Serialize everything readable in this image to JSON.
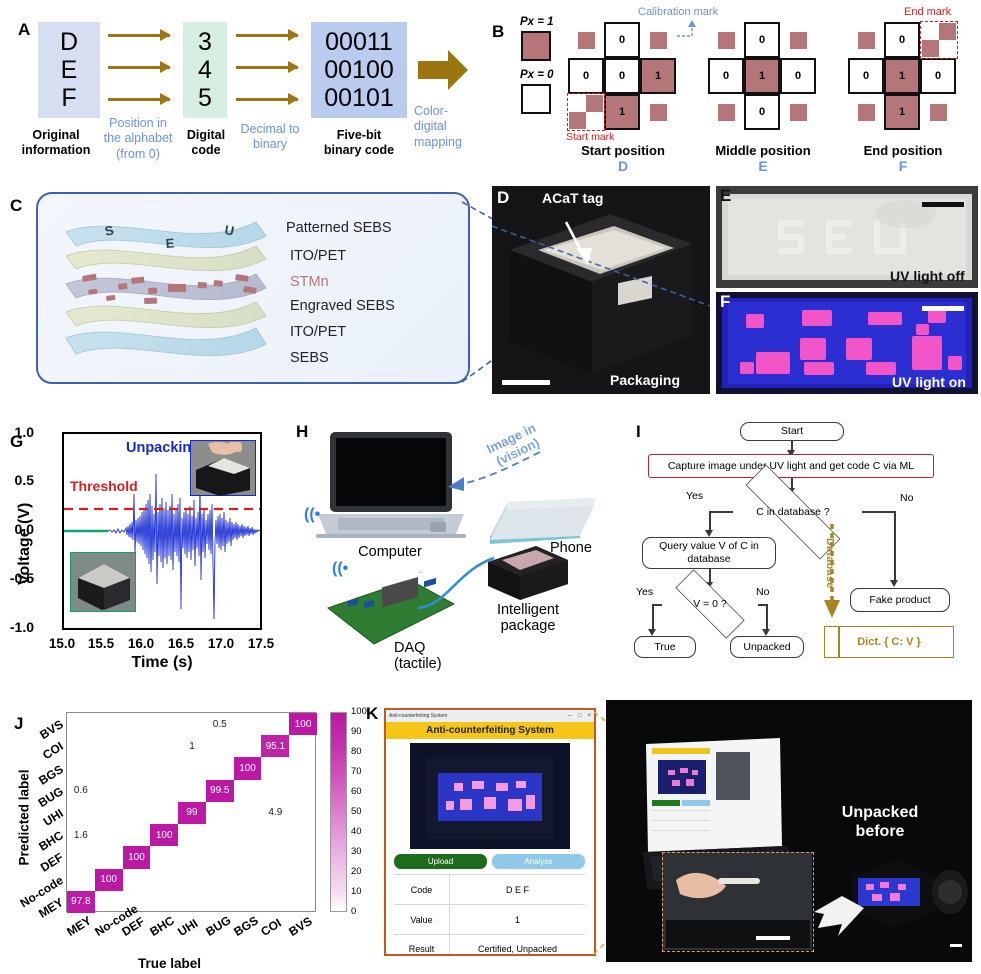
{
  "panels": {
    "A": {
      "letter": "A"
    },
    "B": {
      "letter": "B"
    },
    "C": {
      "letter": "C"
    },
    "D": {
      "letter": "D"
    },
    "E": {
      "letter": "E"
    },
    "F": {
      "letter": "F"
    },
    "G": {
      "letter": "G"
    },
    "H": {
      "letter": "H"
    },
    "I": {
      "letter": "I"
    },
    "J": {
      "letter": "J"
    },
    "K": {
      "letter": "K"
    }
  },
  "panelA": {
    "letters": [
      "D",
      "E",
      "F"
    ],
    "digital_codes": [
      "3",
      "4",
      "5"
    ],
    "binary_codes": [
      "00011",
      "00100",
      "00101"
    ],
    "caption_original": "Original\ninformation",
    "caption_position": "Position in\nthe alphabet\n(from 0)",
    "caption_digital": "Digital\ncode",
    "caption_dec2bin": "Decimal to\nbinary",
    "caption_fivebit": "Five-bit\nbinary code",
    "caption_colormap": "Color-\ndigital\nmapping",
    "arrow_color": "#9a7510",
    "box_colors": {
      "original": "#d6def2",
      "digital": "#d7efe2",
      "binary": "#b9cbee"
    }
  },
  "panelB": {
    "legend_on": "Px = 1",
    "legend_off": "Px = 0",
    "calibration_label": "Calibration mark",
    "start_mark_label": "Start mark",
    "end_mark_label": "End mark",
    "fill_color": "#b5767a",
    "grids": [
      {
        "name": "start",
        "caption": "Start position",
        "letter": "D",
        "bits": {
          "top": "0",
          "left": "0",
          "center": "0",
          "right": "1",
          "bottom": "1"
        },
        "on": {
          "top": false,
          "left": false,
          "center": false,
          "right": true,
          "bottom": true
        }
      },
      {
        "name": "middle",
        "caption": "Middle position",
        "letter": "E",
        "bits": {
          "top": "0",
          "left": "0",
          "center": "1",
          "right": "0",
          "bottom": "0"
        },
        "on": {
          "top": false,
          "left": false,
          "center": true,
          "right": false,
          "bottom": false
        }
      },
      {
        "name": "end",
        "caption": "End position",
        "letter": "F",
        "bits": {
          "top": "0",
          "left": "0",
          "center": "1",
          "right": "0",
          "bottom": "1"
        },
        "on": {
          "top": false,
          "left": false,
          "center": true,
          "right": false,
          "bottom": true
        }
      }
    ]
  },
  "panelC": {
    "layers": [
      "Patterned SEBS",
      "ITO/PET",
      "STMn",
      "Engraved SEBS",
      "ITO/PET",
      "SEBS"
    ],
    "pattern_letters": [
      "S",
      "E",
      "U"
    ],
    "stmn_color": "#b5767a",
    "border_color": "#3c63ac"
  },
  "panelD": {
    "annotation": "ACaT  tag",
    "caption": "Packaging"
  },
  "panelE": {
    "caption": "UV light off",
    "engraved_text": "SEU"
  },
  "panelF": {
    "caption": "UV light on"
  },
  "panelG": {
    "chart_data": {
      "type": "line",
      "title": "",
      "xlabel": "Time (s)",
      "ylabel": "Voltage (V)",
      "xlim": [
        15.0,
        17.5
      ],
      "ylim": [
        -1.0,
        1.0
      ],
      "xticks": [
        "15.0",
        "15.5",
        "16.0",
        "16.5",
        "17.0",
        "17.5"
      ],
      "yticks": [
        "1.0",
        "0.5",
        "0.0",
        "-0.5",
        "-1.0"
      ],
      "grid": false,
      "annotations": [
        "Unpacking",
        "Threshold"
      ],
      "threshold_value": 0.22,
      "threshold_color": "#d42020",
      "series": [
        {
          "name": "baseline",
          "color": "#00a86b",
          "x_range": [
            15.0,
            15.55
          ],
          "value": 0.0
        },
        {
          "name": "unpacking-signal",
          "color": "#1428d2",
          "x_range": [
            15.55,
            17.5
          ],
          "peak_positive": 0.5,
          "peak_negative": -0.9
        }
      ]
    },
    "label_unpacking": "Unpacking",
    "label_threshold": "Threshold"
  },
  "panelH": {
    "labels": {
      "computer": "Computer",
      "phone": "Phone",
      "intelligent_package": "Intelligent\npackage",
      "daq": "DAQ\n(tactile)",
      "image_in_vision": "Image in\n(vision)"
    }
  },
  "panelI": {
    "nodes": {
      "start": "Start",
      "capture": "Capture image under UV light and get code C via ML",
      "decision_db": "C in database ?",
      "query": "Query value V of C in database",
      "decision_v": "V = 0 ?",
      "true": "True",
      "unpacked": "Unpacked",
      "fake": "Fake product",
      "dict": "Dict. { C: V }"
    },
    "edge_labels": {
      "yes1": "Yes",
      "no1": "No",
      "yes2": "Yes",
      "no2": "No",
      "database": "Database"
    },
    "dict_color": "#a5851f",
    "capture_border": "#c0272d"
  },
  "panelJ": {
    "chart_data": {
      "type": "heatmap",
      "title": "",
      "xlabel": "True label",
      "ylabel": "Predicted label",
      "x_categories": [
        "MEY",
        "No-code",
        "DEF",
        "BHC",
        "UHI",
        "BUG",
        "BGS",
        "COI",
        "BVS"
      ],
      "y_categories": [
        "BVS",
        "COI",
        "BGS",
        "BUG",
        "UHI",
        "BHC",
        "DEF",
        "No-code",
        "MEY"
      ],
      "colorbar": {
        "min": 0,
        "max": 100,
        "ticks": [
          "100",
          "90",
          "80",
          "70",
          "60",
          "50",
          "40",
          "30",
          "20",
          "10",
          "0"
        ]
      },
      "cells": [
        {
          "true": "MEY",
          "pred": "MEY",
          "value": 97.8
        },
        {
          "true": "MEY",
          "pred": "BHC",
          "value": 1.6
        },
        {
          "true": "MEY",
          "pred": "BUG",
          "value": 0.6
        },
        {
          "true": "No-code",
          "pred": "No-code",
          "value": 100
        },
        {
          "true": "DEF",
          "pred": "DEF",
          "value": 100
        },
        {
          "true": "BHC",
          "pred": "BHC",
          "value": 100
        },
        {
          "true": "UHI",
          "pred": "UHI",
          "value": 99
        },
        {
          "true": "UHI",
          "pred": "COI",
          "value": 1
        },
        {
          "true": "BUG",
          "pred": "BUG",
          "value": 99.5
        },
        {
          "true": "BUG",
          "pred": "BVS",
          "value": 0.5
        },
        {
          "true": "BGS",
          "pred": "BGS",
          "value": 100
        },
        {
          "true": "COI",
          "pred": "COI",
          "value": 95.1
        },
        {
          "true": "COI",
          "pred": "UHI",
          "value": 4.9
        },
        {
          "true": "BVS",
          "pred": "BVS",
          "value": 100
        }
      ]
    }
  },
  "panelK": {
    "window_title": "Anti-counterfeiting System",
    "banner": "Anti-counterfeiting System",
    "buttons": {
      "upload": "Upload",
      "analyse": "Analyse"
    },
    "titlebar_buttons": [
      "─",
      "□",
      "×"
    ],
    "table": [
      {
        "key": "Code",
        "value": "D E F"
      },
      {
        "key": "Value",
        "value": "1"
      },
      {
        "key": "Result",
        "value": "Certified, Unpacked"
      }
    ],
    "photo_annotation": "Unpacked\nbefore"
  }
}
